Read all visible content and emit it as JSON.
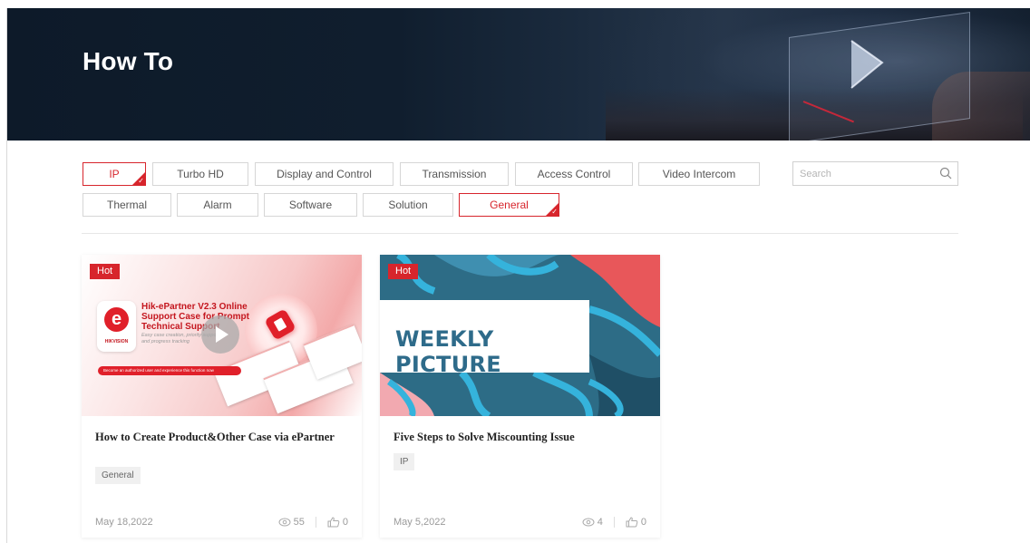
{
  "header": {
    "title": "How To"
  },
  "filters": {
    "row1": [
      {
        "label": "IP",
        "active": true
      },
      {
        "label": "Turbo HD",
        "active": false
      },
      {
        "label": "Display and Control",
        "active": false
      },
      {
        "label": "Transmission",
        "active": false
      },
      {
        "label": "Access Control",
        "active": false
      },
      {
        "label": "Video Intercom",
        "active": false
      }
    ],
    "row2": [
      {
        "label": "Thermal",
        "active": false
      },
      {
        "label": "Alarm",
        "active": false
      },
      {
        "label": "Software",
        "active": false
      },
      {
        "label": "Solution",
        "active": false
      },
      {
        "label": "General",
        "active": true
      }
    ],
    "active_color": "#d7252c"
  },
  "search": {
    "placeholder": "Search",
    "icon": "search-icon"
  },
  "cards": [
    {
      "badge": "Hot",
      "title": "How to Create Product&Other Case via ePartner",
      "tag": "General",
      "date": "May 18,2022",
      "views": "55",
      "likes": "0",
      "thumb": {
        "heading": "Hik-ePartner V2.3 Online Support Case for Prompt Technical Support",
        "subtext": "Easy case creation, priority support and progress tracking",
        "bar_text": "Become an authorized user and experience this function now",
        "brand": "HIKVISION",
        "logo_letter": "e"
      }
    },
    {
      "badge": "Hot",
      "title": "Five Steps to Solve Miscounting Issue",
      "tag": "IP",
      "date": "May 5,2022",
      "views": "4",
      "likes": "0",
      "thumb": {
        "heading": "WEEKLY PICTURE"
      }
    }
  ],
  "colors": {
    "brand_red": "#d7252c",
    "hero_bg": "#0d1a29",
    "weekly_blue": "#2e6b8a"
  }
}
